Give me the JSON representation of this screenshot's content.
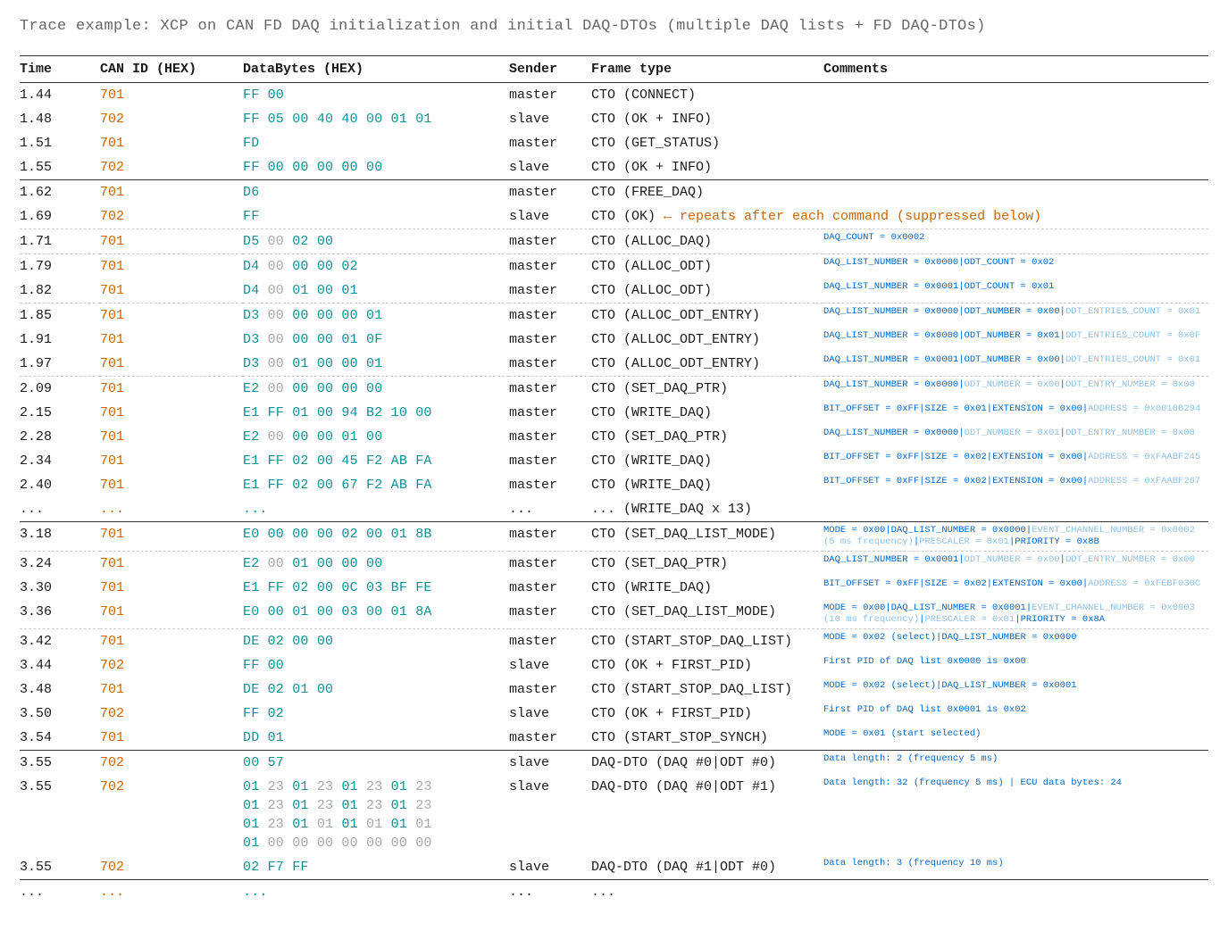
{
  "title": "Trace example: XCP on CAN FD DAQ initialization and initial DAQ-DTOs (multiple DAQ lists + FD DAQ-DTOs)",
  "headers": {
    "time": "Time",
    "canid": "CAN ID (HEX)",
    "data": "DataBytes (HEX)",
    "sender": "Sender",
    "frame": "Frame type",
    "comments": "Comments"
  },
  "rows": [
    {
      "time": "1.44",
      "id": "701",
      "data": [
        {
          "t": "FF 00",
          "f": false
        }
      ],
      "sender": "master",
      "frame": "CTO (CONNECT)",
      "comment": [],
      "border": "none"
    },
    {
      "time": "1.48",
      "id": "702",
      "data": [
        {
          "t": "FF 05 00 40 40 00 01 01",
          "f": false
        }
      ],
      "sender": "slave",
      "frame": "CTO (OK + INFO)",
      "comment": [],
      "border": "none"
    },
    {
      "time": "1.51",
      "id": "701",
      "data": [
        {
          "t": "FD",
          "f": false
        }
      ],
      "sender": "master",
      "frame": "CTO (GET_STATUS)",
      "comment": [],
      "border": "none"
    },
    {
      "time": "1.55",
      "id": "702",
      "data": [
        {
          "t": "FF 00 00 00 00 00",
          "f": false
        }
      ],
      "sender": "slave",
      "frame": "CTO (OK + INFO)",
      "comment": [],
      "border": "solid"
    },
    {
      "time": "1.62",
      "id": "701",
      "data": [
        {
          "t": "D6",
          "f": false
        }
      ],
      "sender": "master",
      "frame": "CTO (FREE_DAQ)",
      "comment": [],
      "border": "none"
    },
    {
      "time": "1.69",
      "id": "702",
      "data": [
        {
          "t": "FF",
          "f": false
        }
      ],
      "sender": "slave",
      "frame_html": "CTO (OK) <span class=\"arrow-note\">← repeats after each command (suppressed below)</span>",
      "comment": [],
      "border": "dash"
    },
    {
      "time": "1.71",
      "id": "701",
      "data": [
        {
          "t": "D5",
          "f": false
        },
        {
          "t": " 00 ",
          "f": true
        },
        {
          "t": "02 00",
          "f": false
        }
      ],
      "sender": "master",
      "frame": "CTO (ALLOC_DAQ)",
      "comment": [
        {
          "t": "DAQ_COUNT = 0x0002",
          "f": false
        }
      ],
      "border": "dash"
    },
    {
      "time": "1.79",
      "id": "701",
      "data": [
        {
          "t": "D4",
          "f": false
        },
        {
          "t": " 00 ",
          "f": true
        },
        {
          "t": "00 00 02",
          "f": false
        }
      ],
      "sender": "master",
      "frame": "CTO (ALLOC_ODT)",
      "comment": [
        {
          "t": "DAQ_LIST_NUMBER = 0x0000",
          "f": false
        },
        {
          "t": "|",
          "f": false
        },
        {
          "t": "ODT_COUNT = 0x02",
          "f": false
        }
      ],
      "border": "none"
    },
    {
      "time": "1.82",
      "id": "701",
      "data": [
        {
          "t": "D4",
          "f": false
        },
        {
          "t": " 00 ",
          "f": true
        },
        {
          "t": "01 00 01",
          "f": false
        }
      ],
      "sender": "master",
      "frame": "CTO (ALLOC_ODT)",
      "comment": [
        {
          "t": "DAQ_LIST_NUMBER = 0x0001",
          "f": false
        },
        {
          "t": "|",
          "f": false
        },
        {
          "t": "ODT_COUNT = 0x01",
          "f": false
        }
      ],
      "border": "dash"
    },
    {
      "time": "1.85",
      "id": "701",
      "data": [
        {
          "t": "D3",
          "f": false
        },
        {
          "t": " 00 ",
          "f": true
        },
        {
          "t": "00 00 00 01",
          "f": false
        }
      ],
      "sender": "master",
      "frame": "CTO (ALLOC_ODT_ENTRY)",
      "comment": [
        {
          "t": "DAQ_LIST_NUMBER = 0x0000",
          "f": false
        },
        {
          "t": "|",
          "f": false
        },
        {
          "t": "ODT_NUMBER = 0x00",
          "f": false
        },
        {
          "t": "|",
          "f": false
        },
        {
          "t": "ODT_ENTRIES_COUNT = 0x01",
          "f": true
        }
      ],
      "border": "none"
    },
    {
      "time": "1.91",
      "id": "701",
      "data": [
        {
          "t": "D3",
          "f": false
        },
        {
          "t": " 00 ",
          "f": true
        },
        {
          "t": "00 00 01 0F",
          "f": false
        }
      ],
      "sender": "master",
      "frame": "CTO (ALLOC_ODT_ENTRY)",
      "comment": [
        {
          "t": "DAQ_LIST_NUMBER = 0x0000",
          "f": false
        },
        {
          "t": "|",
          "f": false
        },
        {
          "t": "ODT_NUMBER = 0x01",
          "f": false
        },
        {
          "t": "|",
          "f": false
        },
        {
          "t": "ODT_ENTRIES_COUNT = 0x0F",
          "f": true
        }
      ],
      "border": "none"
    },
    {
      "time": "1.97",
      "id": "701",
      "data": [
        {
          "t": "D3",
          "f": false
        },
        {
          "t": " 00 ",
          "f": true
        },
        {
          "t": "01 00 00 01",
          "f": false
        }
      ],
      "sender": "master",
      "frame": "CTO (ALLOC_ODT_ENTRY)",
      "comment": [
        {
          "t": "DAQ_LIST_NUMBER = 0x0001",
          "f": false
        },
        {
          "t": "|",
          "f": false
        },
        {
          "t": "ODT_NUMBER = 0x00",
          "f": false
        },
        {
          "t": "|",
          "f": false
        },
        {
          "t": "ODT_ENTRIES_COUNT = 0x01",
          "f": true
        }
      ],
      "border": "dash"
    },
    {
      "time": "2.09",
      "id": "701",
      "data": [
        {
          "t": "E2",
          "f": false
        },
        {
          "t": " 00 ",
          "f": true
        },
        {
          "t": "00 00 00 00",
          "f": false
        }
      ],
      "sender": "master",
      "frame": "CTO (SET_DAQ_PTR)",
      "comment": [
        {
          "t": "DAQ_LIST_NUMBER = 0x0000",
          "f": false
        },
        {
          "t": "|",
          "f": false
        },
        {
          "t": "ODT_NUMBER = 0x00",
          "f": true
        },
        {
          "t": "|",
          "f": false
        },
        {
          "t": "ODT_ENTRY_NUMBER = 0x00",
          "f": true
        }
      ],
      "border": "none"
    },
    {
      "time": "2.15",
      "id": "701",
      "data": [
        {
          "t": "E1 FF 01 00 94 B2 10 00",
          "f": false
        }
      ],
      "sender": "master",
      "frame": "CTO (WRITE_DAQ)",
      "comment": [
        {
          "t": "BIT_OFFSET = 0xFF",
          "f": false
        },
        {
          "t": "|",
          "f": false
        },
        {
          "t": "SIZE = 0x01",
          "f": false
        },
        {
          "t": "|",
          "f": false
        },
        {
          "t": "EXTENSION = 0x00",
          "f": false
        },
        {
          "t": "|",
          "f": false
        },
        {
          "t": "ADDRESS = 0x0010B294",
          "f": true
        }
      ],
      "border": "none"
    },
    {
      "time": "2.28",
      "id": "701",
      "data": [
        {
          "t": "E2",
          "f": false
        },
        {
          "t": " 00 ",
          "f": true
        },
        {
          "t": "00 00 01 00",
          "f": false
        }
      ],
      "sender": "master",
      "frame": "CTO (SET_DAQ_PTR)",
      "comment": [
        {
          "t": "DAQ_LIST_NUMBER = 0x0000",
          "f": false
        },
        {
          "t": "|",
          "f": false
        },
        {
          "t": "ODT_NUMBER = 0x01",
          "f": true
        },
        {
          "t": "|",
          "f": false
        },
        {
          "t": "ODT_ENTRY_NUMBER = 0x00",
          "f": true
        }
      ],
      "border": "none"
    },
    {
      "time": "2.34",
      "id": "701",
      "data": [
        {
          "t": "E1 FF 02 00 45 F2 AB FA",
          "f": false
        }
      ],
      "sender": "master",
      "frame": "CTO (WRITE_DAQ)",
      "comment": [
        {
          "t": "BIT_OFFSET = 0xFF",
          "f": false
        },
        {
          "t": "|",
          "f": false
        },
        {
          "t": "SIZE = 0x02",
          "f": false
        },
        {
          "t": "|",
          "f": false
        },
        {
          "t": "EXTENSION = 0x00",
          "f": false
        },
        {
          "t": "|",
          "f": false
        },
        {
          "t": "ADDRESS = 0xFAABF245",
          "f": true
        }
      ],
      "border": "none"
    },
    {
      "time": "2.40",
      "id": "701",
      "data": [
        {
          "t": "E1 FF 02 00 67 F2 AB FA",
          "f": false
        }
      ],
      "sender": "master",
      "frame": "CTO (WRITE_DAQ)",
      "comment": [
        {
          "t": "BIT_OFFSET = 0xFF",
          "f": false
        },
        {
          "t": "|",
          "f": false
        },
        {
          "t": "SIZE = 0x02",
          "f": false
        },
        {
          "t": "|",
          "f": false
        },
        {
          "t": "EXTENSION = 0x00",
          "f": false
        },
        {
          "t": "|",
          "f": false
        },
        {
          "t": "ADDRESS = 0xFAABF267",
          "f": true
        }
      ],
      "border": "none"
    },
    {
      "time": "...",
      "id": "...",
      "data": [
        {
          "t": "...",
          "f": false
        }
      ],
      "sender": "...",
      "frame": "... (WRITE_DAQ x 13)",
      "comment": [],
      "border": "solid",
      "ell": true
    },
    {
      "time": "3.18",
      "id": "701",
      "data": [
        {
          "t": "E0 00 00 00 02 00 01 8B",
          "f": false
        }
      ],
      "sender": "master",
      "frame": "CTO (SET_DAQ_LIST_MODE)",
      "comment": [
        {
          "t": "MODE = 0x00",
          "f": false
        },
        {
          "t": "|",
          "f": false
        },
        {
          "t": "DAQ_LIST_NUMBER = 0x0000",
          "f": false
        },
        {
          "t": "|",
          "f": false
        },
        {
          "t": "EVENT_CHANNEL_NUMBER = 0x0002\n(5 ms frequency)",
          "f": true
        },
        {
          "t": "|",
          "f": false
        },
        {
          "t": "PRESCALER = 0x01",
          "f": true
        },
        {
          "t": "|",
          "f": false
        },
        {
          "t": "PRIORITY = 0x8B",
          "f": false
        }
      ],
      "border": "dash"
    },
    {
      "time": "3.24",
      "id": "701",
      "data": [
        {
          "t": "E2",
          "f": false
        },
        {
          "t": " 00 ",
          "f": true
        },
        {
          "t": "01 00 00 00",
          "f": false
        }
      ],
      "sender": "master",
      "frame": "CTO (SET_DAQ_PTR)",
      "comment": [
        {
          "t": "DAQ_LIST_NUMBER = 0x0001",
          "f": false
        },
        {
          "t": "|",
          "f": false
        },
        {
          "t": "ODT_NUMBER = 0x00",
          "f": true
        },
        {
          "t": "|",
          "f": false
        },
        {
          "t": "ODT_ENTRY_NUMBER = 0x00",
          "f": true
        }
      ],
      "border": "none"
    },
    {
      "time": "3.30",
      "id": "701",
      "data": [
        {
          "t": "E1 FF 02 00 0C 03 BF FE",
          "f": false
        }
      ],
      "sender": "master",
      "frame": "CTO (WRITE_DAQ)",
      "comment": [
        {
          "t": "BIT_OFFSET = 0xFF",
          "f": false
        },
        {
          "t": "|",
          "f": false
        },
        {
          "t": "SIZE = 0x02",
          "f": false
        },
        {
          "t": "|",
          "f": false
        },
        {
          "t": "EXTENSION = 0x00",
          "f": false
        },
        {
          "t": "|",
          "f": false
        },
        {
          "t": "ADDRESS = 0xFEBF030C",
          "f": true
        }
      ],
      "border": "none"
    },
    {
      "time": "3.36",
      "id": "701",
      "data": [
        {
          "t": "E0 00 01 00 03 00 01 8A",
          "f": false
        }
      ],
      "sender": "master",
      "frame": "CTO (SET_DAQ_LIST_MODE)",
      "comment": [
        {
          "t": "MODE = 0x00",
          "f": false
        },
        {
          "t": "|",
          "f": false
        },
        {
          "t": "DAQ_LIST_NUMBER = 0x0001",
          "f": false
        },
        {
          "t": "|",
          "f": false
        },
        {
          "t": "EVENT_CHANNEL_NUMBER = 0x0003\n(10 ms frequency)",
          "f": true
        },
        {
          "t": "|",
          "f": false
        },
        {
          "t": "PRESCALER = 0x01",
          "f": true
        },
        {
          "t": "|",
          "f": false
        },
        {
          "t": "PRIORITY = 0x8A",
          "f": false
        }
      ],
      "border": "dash"
    },
    {
      "time": "3.42",
      "id": "701",
      "data": [
        {
          "t": "DE 02 00 00",
          "f": false
        }
      ],
      "sender": "master",
      "frame": "CTO (START_STOP_DAQ_LIST)",
      "comment": [
        {
          "t": "MODE = 0x02 (select)",
          "f": false
        },
        {
          "t": "|",
          "f": false
        },
        {
          "t": "DAQ_LIST_NUMBER = 0x0000",
          "f": false
        }
      ],
      "border": "none"
    },
    {
      "time": "3.44",
      "id": "702",
      "data": [
        {
          "t": "FF 00",
          "f": false
        }
      ],
      "sender": "slave",
      "frame": "CTO (OK + FIRST_PID)",
      "comment": [
        {
          "t": "First PID of DAQ list 0x0000 is 0x00",
          "f": false
        }
      ],
      "border": "none"
    },
    {
      "time": "3.48",
      "id": "701",
      "data": [
        {
          "t": "DE 02 01 00",
          "f": false
        }
      ],
      "sender": "master",
      "frame": "CTO (START_STOP_DAQ_LIST)",
      "comment": [
        {
          "t": "MODE = 0x02 (select)",
          "f": false
        },
        {
          "t": "|",
          "f": false
        },
        {
          "t": "DAQ_LIST_NUMBER = 0x0001",
          "f": false
        }
      ],
      "border": "none"
    },
    {
      "time": "3.50",
      "id": "702",
      "data": [
        {
          "t": "FF 02",
          "f": false
        }
      ],
      "sender": "slave",
      "frame": "CTO (OK + FIRST_PID)",
      "comment": [
        {
          "t": "First PID of DAQ list 0x0001 is 0x02",
          "f": false
        }
      ],
      "border": "none"
    },
    {
      "time": "3.54",
      "id": "701",
      "data": [
        {
          "t": "DD 01",
          "f": false
        }
      ],
      "sender": "master",
      "frame": "CTO (START_STOP_SYNCH)",
      "comment": [
        {
          "t": "MODE = 0x01 (start selected)",
          "f": false
        }
      ],
      "border": "solid"
    },
    {
      "time": "3.55",
      "id": "702",
      "data": [
        {
          "t": "00 57",
          "f": false
        }
      ],
      "sender": "slave",
      "frame": "DAQ-DTO (DAQ #0|ODT #0)",
      "comment": [
        {
          "t": "Data length: 2 (frequency 5 ms)",
          "f": false
        }
      ],
      "border": "none"
    },
    {
      "time": "3.55",
      "id": "702",
      "data": [
        {
          "t": "01 ",
          "f": false
        },
        {
          "t": "23 ",
          "f": true
        },
        {
          "t": "01 ",
          "f": false
        },
        {
          "t": "23 ",
          "f": true
        },
        {
          "t": "01 ",
          "f": false
        },
        {
          "t": "23 ",
          "f": true
        },
        {
          "t": "01 ",
          "f": false
        },
        {
          "t": "23",
          "f": true
        },
        {
          "t": "\n",
          "f": false
        },
        {
          "t": "01 ",
          "f": false
        },
        {
          "t": "23 ",
          "f": true
        },
        {
          "t": "01 ",
          "f": false
        },
        {
          "t": "23 ",
          "f": true
        },
        {
          "t": "01 ",
          "f": false
        },
        {
          "t": "23 ",
          "f": true
        },
        {
          "t": "01 ",
          "f": false
        },
        {
          "t": "23",
          "f": true
        },
        {
          "t": "\n",
          "f": false
        },
        {
          "t": "01 ",
          "f": false
        },
        {
          "t": "23 ",
          "f": true
        },
        {
          "t": "01 ",
          "f": false
        },
        {
          "t": "01 ",
          "f": true
        },
        {
          "t": "01 ",
          "f": false
        },
        {
          "t": "01 ",
          "f": true
        },
        {
          "t": "01 ",
          "f": false
        },
        {
          "t": "01",
          "f": true
        },
        {
          "t": "\n",
          "f": false
        },
        {
          "t": "01",
          "f": false
        },
        {
          "t": " 00 00 00 00 00 00 00",
          "f": true
        }
      ],
      "sender": "slave",
      "frame": "DAQ-DTO (DAQ #0|ODT #1)",
      "comment": [
        {
          "t": "Data length: 32 (frequency 5 ms) | ECU data bytes: 24",
          "f": false
        }
      ],
      "border": "none"
    },
    {
      "time": "3.55",
      "id": "702",
      "data": [
        {
          "t": "02 F7 FF",
          "f": false
        }
      ],
      "sender": "slave",
      "frame": "DAQ-DTO (DAQ #1|ODT #0)",
      "comment": [
        {
          "t": "Data length: 3 (frequency 10 ms)",
          "f": false
        }
      ],
      "border": "solid"
    },
    {
      "time": "...",
      "id": "...",
      "data": [
        {
          "t": "...",
          "f": false
        }
      ],
      "sender": "...",
      "frame": "...",
      "comment": [],
      "border": "none",
      "ell": true
    }
  ]
}
